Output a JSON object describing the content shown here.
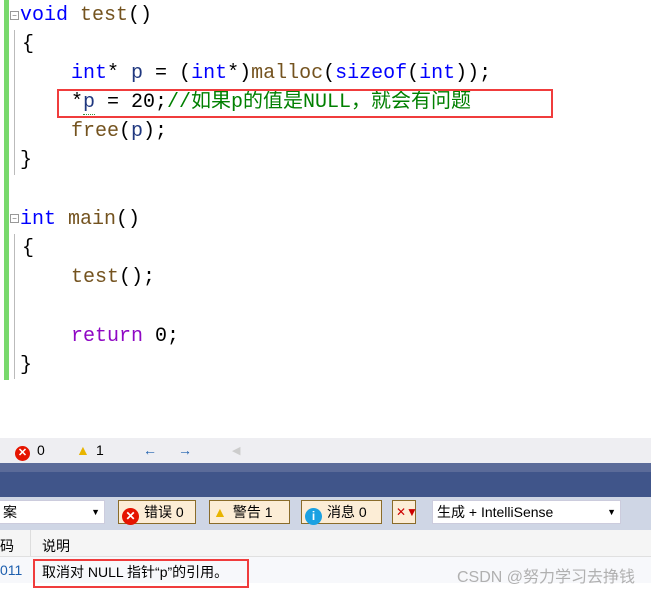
{
  "code": {
    "l1": {
      "kw": "void",
      "fn": " test",
      "p": "()"
    },
    "l2": "{",
    "l3": {
      "kw1": "int",
      "t1": "* ",
      "v": "p",
      "t2": " = (",
      "kw2": "int",
      "t3": "*)",
      "fn": "malloc",
      "t4": "(",
      "kw3": "sizeof",
      "t5": "(",
      "kw4": "int",
      "t6": "));"
    },
    "l4": {
      "t1": "*",
      "v": "p",
      "t2": " = 20;",
      "cm": "//如果p的值是NULL，就会有问题"
    },
    "l5": {
      "fn": "free",
      "t1": "(",
      "v": "p",
      "t2": ");"
    },
    "l6": "}",
    "l7": {
      "kw": "int",
      "fn": " main",
      "p": "()"
    },
    "l8": "{",
    "l9": {
      "fn": "test",
      "p": "();"
    },
    "l10": {
      "kw": "return",
      "p": " 0;"
    },
    "l11": "}"
  },
  "status": {
    "errors": "0",
    "warnings": "1"
  },
  "toolbar": {
    "scope": "案",
    "errors_btn": "错误 0",
    "warnings_btn": "警告 1",
    "messages_btn": "消息 0",
    "source": "生成 + IntelliSense"
  },
  "table": {
    "headers": [
      "码",
      "说明"
    ],
    "rows": [
      {
        "code": "011",
        "description": "取消对 NULL 指针“p”的引用。"
      }
    ]
  },
  "watermark": "CSDN @努力学习去挣钱"
}
